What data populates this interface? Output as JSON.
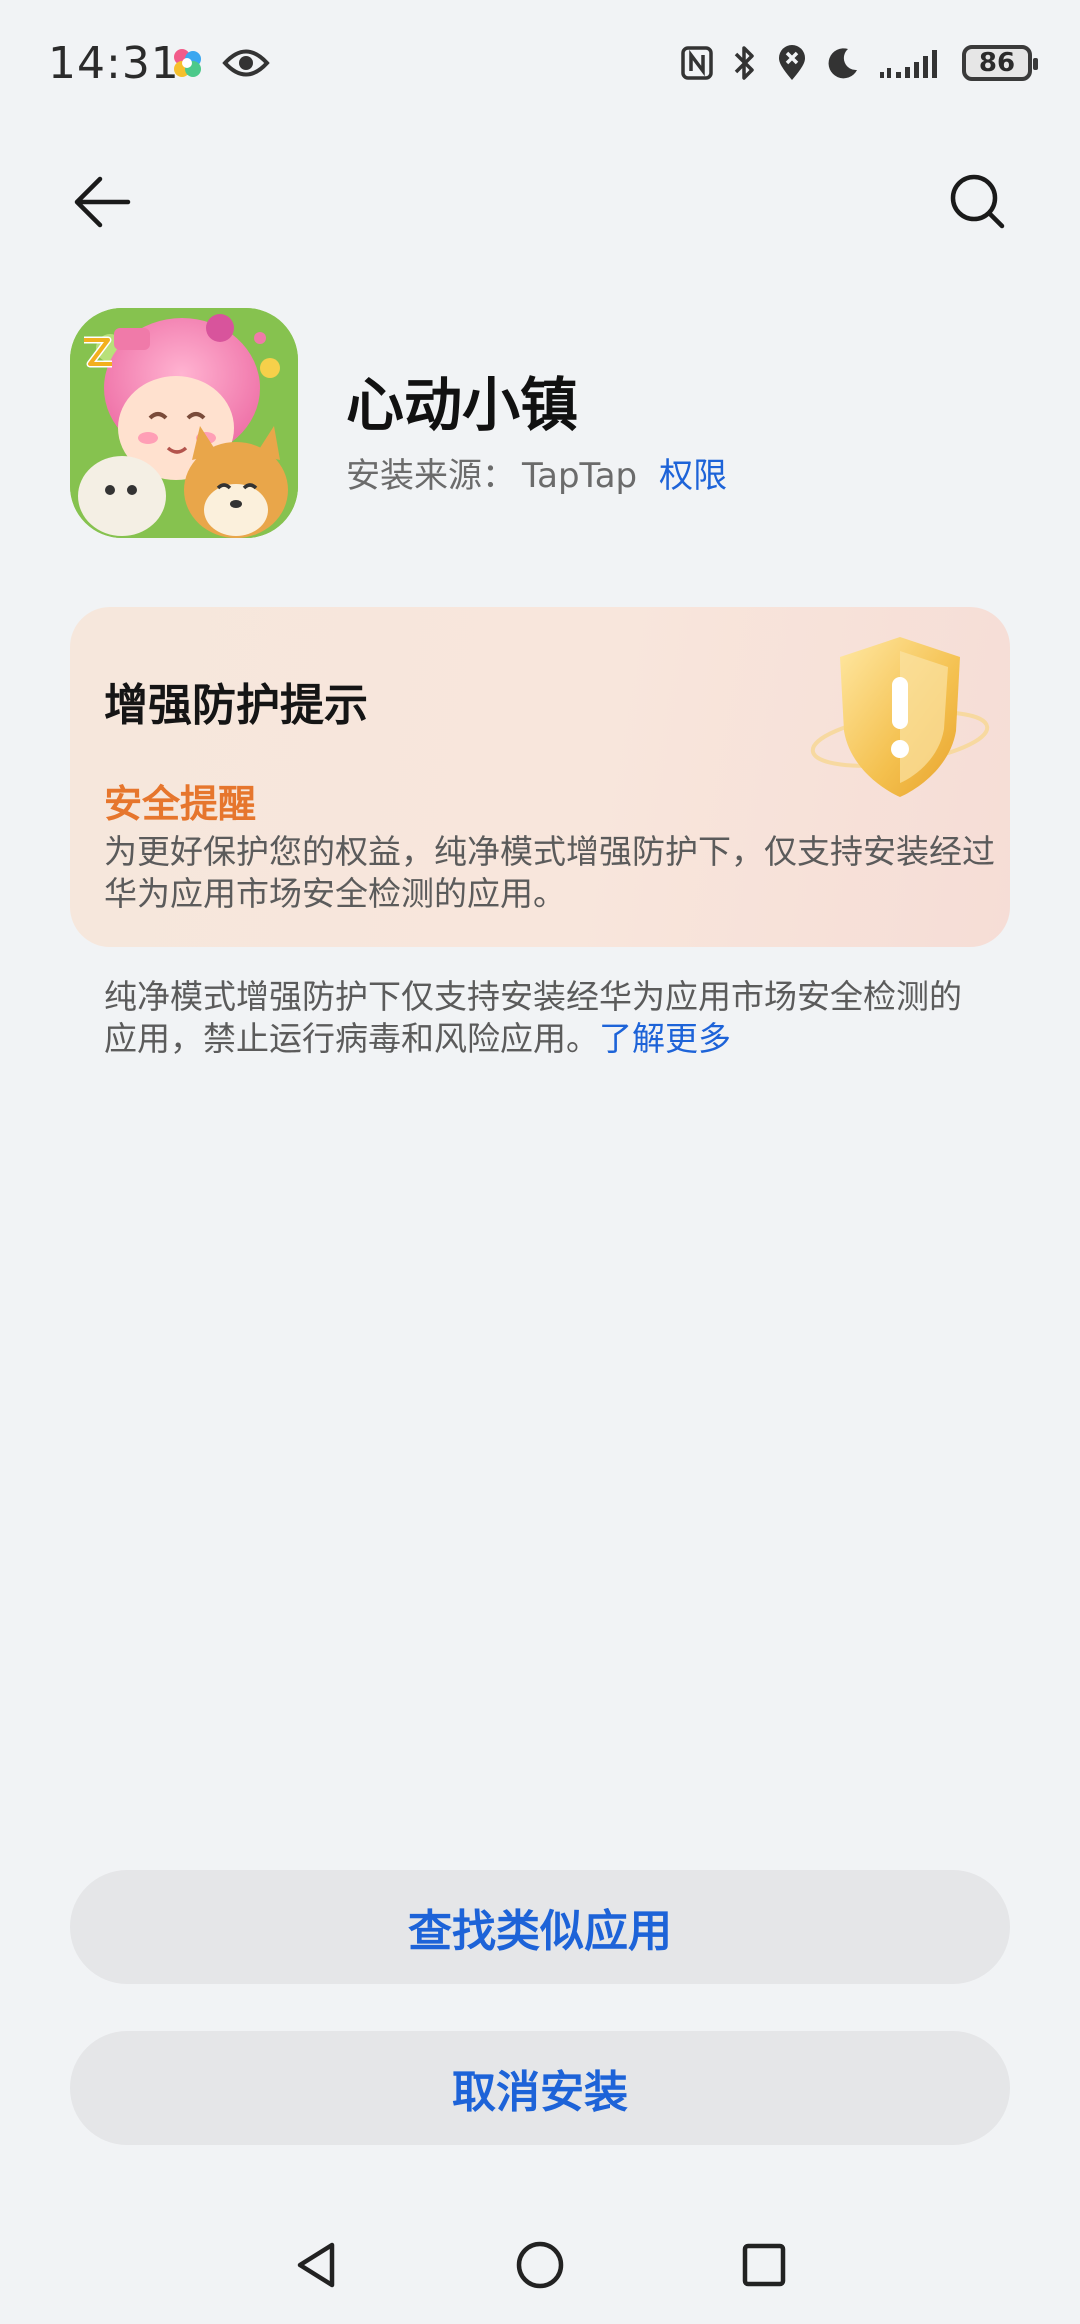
{
  "status_bar": {
    "time": "14:31",
    "battery": "86",
    "icons": [
      "app-notify-icon",
      "eye-icon",
      "nfc-icon",
      "bluetooth-icon",
      "location-icon",
      "moon-icon",
      "signal-icon",
      "battery-icon"
    ]
  },
  "top_bar": {
    "back_icon": "arrow-left-icon",
    "search_icon": "search-icon"
  },
  "app": {
    "name": "心动小镇",
    "source_label": "安装来源：",
    "source_value": "TapTap",
    "permissions_link": "权限"
  },
  "protection_card": {
    "title": "增强防护提示",
    "subtitle": "安全提醒",
    "body": "为更好保护您的权益，纯净模式增强防护下，仅支持安装经过华为应用市场安全检测的应用。",
    "subtitle_color": "#e6762d"
  },
  "note": {
    "text": "纯净模式增强防护下仅支持安装经华为应用市场安全检测的应用，禁止运行病毒和风险应用。",
    "learn_more": "了解更多"
  },
  "buttons": {
    "find_similar": "查找类似应用",
    "cancel_install": "取消安装"
  },
  "nav": {
    "back": "triangle-back-icon",
    "home": "circle-home-icon",
    "recents": "square-recents-icon"
  },
  "colors": {
    "accent": "#1d63d8",
    "background": "#f1f3f5"
  }
}
